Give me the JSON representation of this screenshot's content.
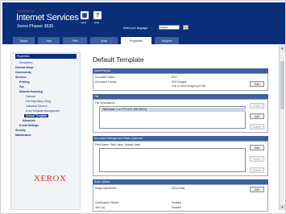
{
  "header": {
    "brand_small": "CentreWare",
    "app_title": "Internet Services",
    "printer_name": "Xerox Phaser 3635",
    "icons": [
      {
        "name": "index-icon",
        "label": "Index"
      },
      {
        "name": "help-icon",
        "label": "Help"
      }
    ],
    "language_label": "Select your language:",
    "language_value": "English",
    "language_go": "Go"
  },
  "tabs": [
    {
      "label": "Status",
      "active": false
    },
    {
      "label": "Jobs",
      "active": false
    },
    {
      "label": "Print",
      "active": false
    },
    {
      "label": "Scan",
      "active": false
    },
    {
      "label": "Properties",
      "active": true
    },
    {
      "label": "Support",
      "active": false
    }
  ],
  "sidebar": {
    "header": "Properties",
    "items": [
      {
        "label": "Description",
        "level": 1,
        "bold": false,
        "selected": false
      },
      {
        "label": "General Setup",
        "level": 0,
        "bold": true,
        "selected": false
      },
      {
        "label": "Connectivity",
        "level": 0,
        "bold": true,
        "selected": false
      },
      {
        "label": "Services",
        "level": 0,
        "bold": true,
        "selected": false
      },
      {
        "label": "Printing",
        "level": 1,
        "bold": true,
        "selected": false
      },
      {
        "label": "Fax",
        "level": 1,
        "bold": true,
        "selected": false
      },
      {
        "label": "Network Scanning",
        "level": 1,
        "bold": true,
        "selected": false
      },
      {
        "label": "General",
        "level": 2,
        "bold": false,
        "selected": false
      },
      {
        "label": "File Repository Setup",
        "level": 2,
        "bold": false,
        "selected": false
      },
      {
        "label": "Validation Servers",
        "level": 2,
        "bold": false,
        "selected": false
      },
      {
        "label": "Scan Template Management",
        "level": 2,
        "bold": false,
        "selected": false
      },
      {
        "label": "Default Template",
        "level": 2,
        "bold": true,
        "selected": true
      },
      {
        "label": "Advanced",
        "level": 2,
        "bold": true,
        "selected": false
      },
      {
        "label": "E-mail Settings",
        "level": 1,
        "bold": true,
        "selected": false
      },
      {
        "label": "Security",
        "level": 0,
        "bold": true,
        "selected": false
      },
      {
        "label": "Maintenance",
        "level": 0,
        "bold": true,
        "selected": false
      }
    ],
    "brand_logo": "XEROX"
  },
  "main": {
    "title": "Default Template",
    "sections": {
      "name_format": {
        "header": "Name/Format",
        "rows": [
          {
            "label": "Document Name",
            "value": "DOC"
          },
          {
            "label": "Document Format",
            "value": "PDF Images"
          },
          {
            "label": "",
            "value": "One or More Images per File"
          }
        ],
        "edit_label": "Edit"
      },
      "file": {
        "header": "File",
        "destinations_label": "File Destinations",
        "list_items": [
          "FileDefault: 1 on FTP (127.198.146.21)"
        ],
        "buttons": [
          "Edit",
          "Add",
          "Delete"
        ]
      },
      "doc_mgmt": {
        "header": "Document Management Fields (Optional)",
        "columns_label": "Field Name, Field Label, Default Value",
        "buttons": [
          "Add",
          "Edit",
          "Delete"
        ]
      },
      "scan_options": {
        "header": "Scan Options",
        "rows": [
          {
            "label": "Image Adjustment",
            "value": "(Send Edit)"
          },
          {
            "label": "Confirmation Report",
            "value": "Enabled"
          },
          {
            "label": "Job Log",
            "value": "Enabled"
          }
        ],
        "edit_label": "Edit"
      }
    }
  },
  "colors": {
    "header_bg": "#0a2f78",
    "tab_bg": "#3d5f9e",
    "brand_red": "#d5322a"
  }
}
